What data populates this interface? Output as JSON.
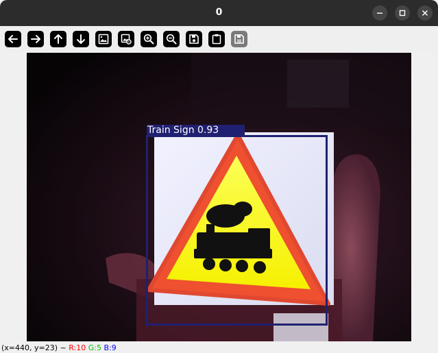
{
  "window": {
    "title": "0"
  },
  "toolbar": {
    "buttons": [
      {
        "name": "back",
        "icon": "arrow-left-icon",
        "enabled": true
      },
      {
        "name": "forward",
        "icon": "arrow-right-icon",
        "enabled": true
      },
      {
        "name": "up",
        "icon": "arrow-up-icon",
        "enabled": true
      },
      {
        "name": "down",
        "icon": "arrow-down-icon",
        "enabled": true
      },
      {
        "name": "image",
        "icon": "image-icon",
        "enabled": true
      },
      {
        "name": "image-settings",
        "icon": "image-gear-icon",
        "enabled": true
      },
      {
        "name": "zoom-in",
        "icon": "zoom-in-icon",
        "enabled": true
      },
      {
        "name": "zoom-out",
        "icon": "zoom-out-icon",
        "enabled": true
      },
      {
        "name": "save",
        "icon": "save-icon",
        "enabled": true
      },
      {
        "name": "copy",
        "icon": "clipboard-icon",
        "enabled": true
      },
      {
        "name": "properties",
        "icon": "properties-icon",
        "enabled": false
      }
    ]
  },
  "detection": {
    "label": "Train Sign 0.93",
    "box_color": "#202070"
  },
  "status": {
    "coords": "(x=440, y=23) ~",
    "r": "R:10",
    "g": "G:5",
    "b": "B:9",
    "r_color": "#ff0000",
    "g_color": "#00c000",
    "b_color": "#0000ff"
  }
}
